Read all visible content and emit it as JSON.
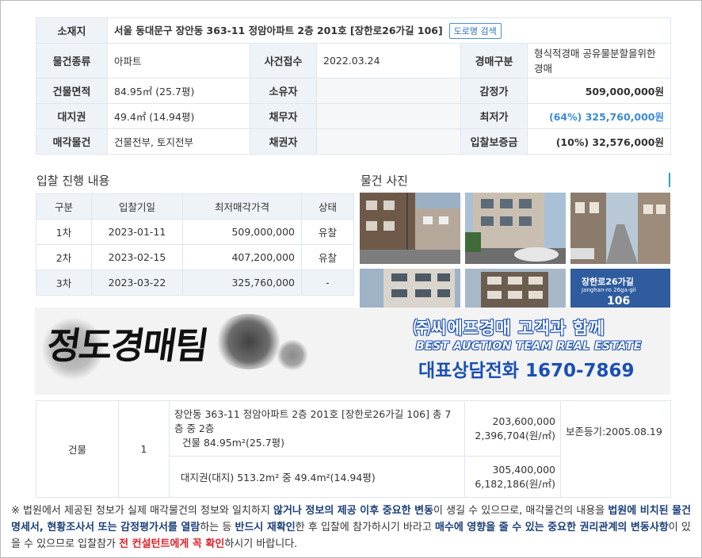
{
  "info": {
    "location_label": "소재지",
    "location_value": "서울 동대문구 장안동 363-11 정암아파트 2층 201호 [장한로26가길 106]",
    "road_search": "도로명 검색",
    "type_label": "물건종류",
    "type_value": "아파트",
    "case_label": "사건접수",
    "case_value": "2022.03.24",
    "auction_kind_label": "경매구분",
    "auction_kind_value": "형식적경매 공유물분할을위한경매",
    "building_area_label": "건물면적",
    "building_area_value": "84.95㎡ (25.7평)",
    "owner_label": "소유자",
    "appraisal_label": "감정가",
    "appraisal_value": "509,000,000원",
    "land_right_label": "대지권",
    "land_right_value": "49.4㎡ (14.94평)",
    "debtor_label": "채무자",
    "min_price_label": "최저가",
    "min_price_value": "(64%) 325,760,000원",
    "sale_item_label": "매각물건",
    "sale_item_value": "건물전부, 토지전부",
    "creditor_label": "채권자",
    "deposit_label": "입찰보증금",
    "deposit_value": "(10%) 32,576,000원"
  },
  "bid_section_title": "입찰 진행 내용",
  "photo_section_title": "물건 사진",
  "bids": {
    "headers": [
      "구분",
      "입찰기일",
      "최저매각가격",
      "상태"
    ],
    "rows": [
      {
        "round": "1차",
        "date": "2023-01-11",
        "price": "509,000,000",
        "status": "유찰"
      },
      {
        "round": "2차",
        "date": "2023-02-15",
        "price": "407,200,000",
        "status": "유찰"
      },
      {
        "round": "3차",
        "date": "2023-03-22",
        "price": "325,760,000",
        "status": "-"
      }
    ]
  },
  "photo_sign": {
    "line1": "장한로26가길",
    "line2": "Janghan-ro 26ga-gil",
    "num": "106"
  },
  "banner": {
    "logo": "정도경매팀",
    "company": "㈜씨에프경매  고객과 함께",
    "english": "BEST AUCTION TEAM  REAL ESTATE",
    "phone": "대표상담전화 1670-7869"
  },
  "detail": {
    "kind": "건물",
    "no": "1",
    "desc_line": "장안동 363-11 정암아파트 2층 201호 [장한로26가길 106] 총 7층 중 2층",
    "building": "건물 84.95m²(25.7평)",
    "building_price": "203,600,000",
    "building_unit": "2,396,704(원/㎡)",
    "preservation": "보존등기:2005.08.19",
    "land": "대지권(대지) 513.2m² 중 49.4m²(14.94평)",
    "land_price": "305,400,000",
    "land_unit": "6,182,186(원/㎡)"
  },
  "notice": {
    "p1": "※ 법원에서 제공된 정보가 실제 매각물건의 정보와 일치하지 ",
    "b1": "않거나 정보의 제공 이후 중요한 변동",
    "p2": "이 생길 수 있으므로, 매각물건의 내용을 ",
    "b2": "법원에 비치된 물건명세서, 현황조사서 또는 감정평가서를 열람",
    "p3": "하는 등 ",
    "b3": "반드시 재확인",
    "p4": "한 후 입찰에 참가하시기 바라고 ",
    "b4": "매수에 영향을 줄 수 있는 중요한 권리관계의 변동사항",
    "p5": "이 있을 수 있으므로 입찰참가 ",
    "b5": "전 컨설턴트에게 꼭 확인",
    "p6": "하시기 바랍니다."
  }
}
